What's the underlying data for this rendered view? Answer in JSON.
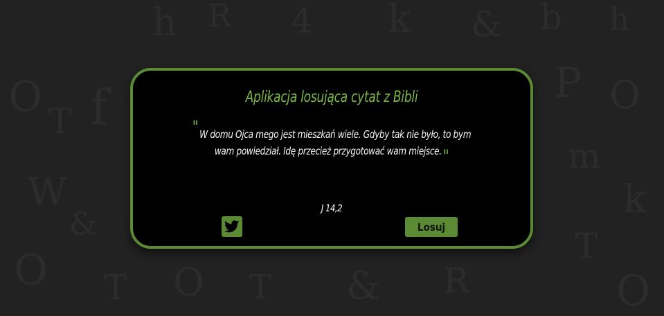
{
  "app": {
    "title": "Aplikacja losująca cytat z Bibli"
  },
  "quote": {
    "open_mark": "\"",
    "text": "W domu Ojca mego jest mieszkań wiele. Gdyby tak nie było, to bym wam powiedział. Idę przecież przygotować wam miejsce.",
    "close_mark": "\"",
    "reference": "J 14,2"
  },
  "actions": {
    "twitter_icon": "twitter-bird-icon",
    "draw_label": "Losuj"
  },
  "colors": {
    "accent": "#5a8a33",
    "title": "#7ab844",
    "card_bg": "#000000",
    "page_bg": "#222222"
  }
}
